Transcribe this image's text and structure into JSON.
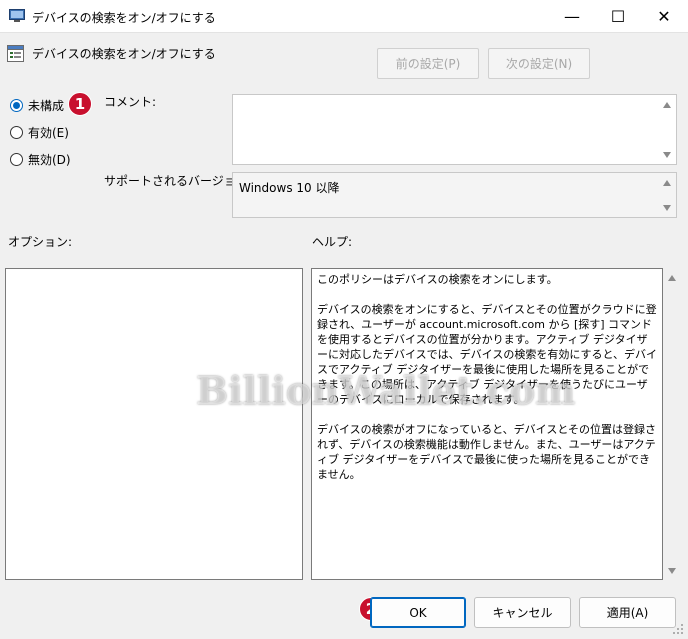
{
  "window": {
    "title": "デバイスの検索をオン/オフにする",
    "minimize": "—",
    "maximize": "☐",
    "close": "✕",
    "icon": "policy-window-icon"
  },
  "policy": {
    "name": "デバイスの検索をオン/オフにする",
    "icon": "policy-setting-icon"
  },
  "nav": {
    "prev_label": "前の設定(P)",
    "next_label": "次の設定(N)"
  },
  "state": {
    "options": [
      {
        "label": "未構成(C)",
        "checked": true
      },
      {
        "label": "有効(E)",
        "checked": false
      },
      {
        "label": "無効(D)",
        "checked": false
      }
    ],
    "visible_first_label": "未構成"
  },
  "annotations": {
    "badge1": "1",
    "badge2": "2",
    "color": "#c8102e"
  },
  "comment": {
    "label": "コメント:",
    "value": ""
  },
  "supported": {
    "label": "サポートされるバージョン:",
    "value": "Windows 10 以降"
  },
  "options_panel": {
    "label": "オプション:"
  },
  "help": {
    "label": "ヘルプ:",
    "paragraphs": [
      "このポリシーはデバイスの検索をオンにします。",
      "デバイスの検索をオンにすると、デバイスとその位置がクラウドに登録され、ユーザーが account.microsoft.com から [探す] コマンドを使用するとデバイスの位置が分かります。アクティブ デジタイザーに対応したデバイスでは、デバイスの検索を有効にすると、デバイスでアクティブ デジタイザーを最後に使用した場所を見ることができます。この場所は、アクティブ デジタイザーを使うたびにユーザーのデバイスにローカルで保存されます。",
      "デバイスの検索がオフになっていると、デバイスとその位置は登録されず、デバイスの検索機能は動作しません。また、ユーザーはアクティブ デジタイザーをデバイスで最後に使った場所を見ることができません。"
    ]
  },
  "buttons": {
    "ok": "OK",
    "cancel": "キャンセル",
    "apply": "適用(A)"
  },
  "watermark": "BillionWallet.com",
  "accent_color": "#0067c0"
}
